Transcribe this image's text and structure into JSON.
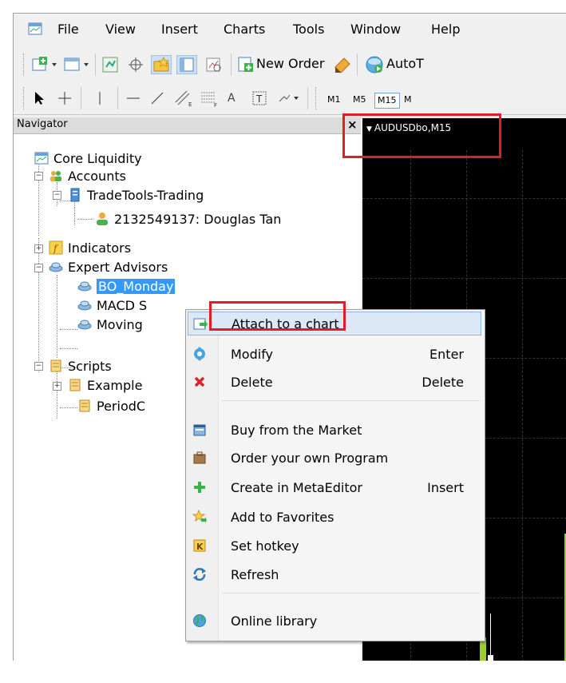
{
  "menu": {
    "items": [
      "File",
      "View",
      "Insert",
      "Charts",
      "Tools",
      "Window",
      "Help"
    ]
  },
  "toolbar": {
    "new_order_label": "New Order",
    "autotrading_label": "AutoT",
    "line_tool_label": "A",
    "timeframes": [
      "M1",
      "M5",
      "M15",
      "M"
    ]
  },
  "navigator": {
    "title": "Navigator",
    "close_glyph": "×",
    "root": "Core Liquidity",
    "accounts": "Accounts",
    "broker": "TradeTools-Trading",
    "account": "2132549137: Douglas Tan",
    "indicators": "Indicators",
    "experts": "Expert Advisors",
    "expert_items": [
      "BO_Monday",
      "MACD S",
      "Moving"
    ],
    "scripts": "Scripts",
    "script_items": [
      "Example",
      "PeriodC"
    ]
  },
  "chart": {
    "tab_label": "AUDUSDbo,M15"
  },
  "context_menu": {
    "items": [
      {
        "label": "Attach to a chart",
        "shortcut": "",
        "icon": "attach-chart-icon"
      },
      {
        "label": "Modify",
        "shortcut": "Enter",
        "icon": "modify-gear-icon"
      },
      {
        "label": "Delete",
        "shortcut": "Delete",
        "icon": "delete-x-icon"
      },
      {
        "label": "Buy from the Market",
        "shortcut": "",
        "icon": "market-icon"
      },
      {
        "label": "Order your own Program",
        "shortcut": "",
        "icon": "briefcase-icon"
      },
      {
        "label": "Create in MetaEditor",
        "shortcut": "Insert",
        "icon": "plus-icon"
      },
      {
        "label": "Add to Favorites",
        "shortcut": "",
        "icon": "favorites-icon"
      },
      {
        "label": "Set hotkey",
        "shortcut": "",
        "icon": "hotkey-icon"
      },
      {
        "label": "Refresh",
        "shortcut": "",
        "icon": "refresh-icon"
      },
      {
        "label": "Online library",
        "shortcut": "",
        "icon": "globe-icon"
      }
    ]
  },
  "colors": {
    "highlight": "#e41c24",
    "selection": "#3399ff",
    "chart_bg": "#000000",
    "candle_up": "#9acd32"
  }
}
